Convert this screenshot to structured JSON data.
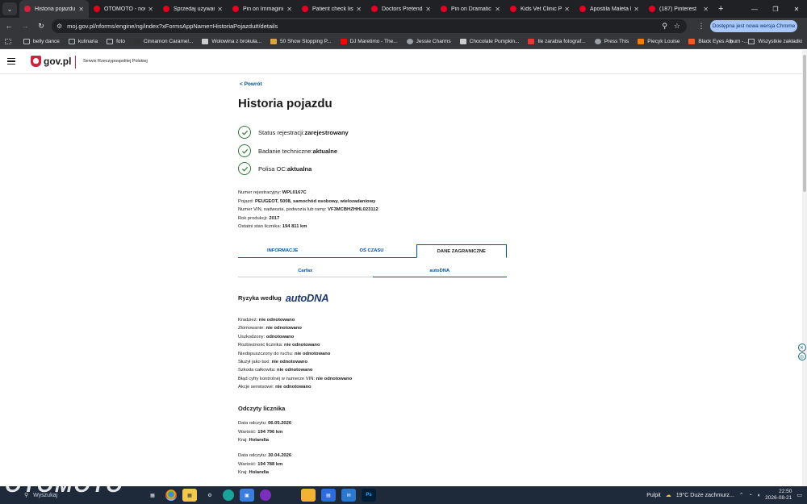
{
  "browser": {
    "tabs": [
      {
        "title": "Historia pojazdu",
        "active": true,
        "favicon_color": "#d4213d"
      },
      {
        "title": "OTOMOTO - nowe",
        "active": false,
        "favicon_color": "#e2001a"
      },
      {
        "title": "Sprzedaj używany",
        "active": false,
        "favicon_color": "#e2001a"
      },
      {
        "title": "Pin on Immagini",
        "active": false,
        "favicon_color": "#e60023"
      },
      {
        "title": "Patient check list",
        "active": false,
        "favicon_color": "#e60023"
      },
      {
        "title": "Doctors Pretend P",
        "active": false,
        "favicon_color": "#e60023"
      },
      {
        "title": "Pin on Dramatic P",
        "active": false,
        "favicon_color": "#e60023"
      },
      {
        "title": "Kids Vet Clinic Pa",
        "active": false,
        "favicon_color": "#e60023"
      },
      {
        "title": "Apostila Maleta M",
        "active": false,
        "favicon_color": "#e60023"
      },
      {
        "title": "(187) Pinterest",
        "active": false,
        "favicon_color": "#e60023"
      }
    ],
    "url": "moj.gov.pl/nforms/engine/ng/index?xFormsAppName=HistoriaPojazdu#/details",
    "update_notice": "Dostępna jest nowa wersja Chrome",
    "bookmarks": [
      {
        "label": "belly dance",
        "icon": "folder-icon"
      },
      {
        "label": "kulinaria",
        "icon": "folder-icon"
      },
      {
        "label": "foto",
        "icon": "folder-icon"
      },
      {
        "label": "Cinnamon Caramel...",
        "icon": "site-icon",
        "color": "#333333"
      },
      {
        "label": "Wołowina z brokuła...",
        "icon": "site-icon",
        "color": "#cccccc"
      },
      {
        "label": "50 Show Stopping P...",
        "icon": "site-icon",
        "color": "#d9a441"
      },
      {
        "label": "DJ Maretimo - The...",
        "icon": "youtube-icon",
        "color": "#ff0000"
      },
      {
        "label": "Jessie Charms",
        "icon": "globe-icon",
        "color": "#9aa0a6"
      },
      {
        "label": "Chocolate Pumpkin...",
        "icon": "site-icon",
        "color": "#cccccc"
      },
      {
        "label": "Ile zarabia fotograf...",
        "icon": "site-icon",
        "color": "#e53935"
      },
      {
        "label": "Press This",
        "icon": "globe-icon",
        "color": "#9aa0a6"
      },
      {
        "label": "Piecyk Louise",
        "icon": "site-icon",
        "color": "#f57c00"
      },
      {
        "label": "Black Eyes Album -...",
        "icon": "site-icon",
        "color": "#ff5722"
      }
    ],
    "bookmarks_all_label": "Wszystkie zakładki"
  },
  "site": {
    "logo": "gov.pl",
    "subtitle": "Serwis Rzeczypospolitej Polskiej",
    "brand_color": "#d4213d"
  },
  "page": {
    "back_link": "< Powrót",
    "title": "Historia pojazdu",
    "statuses": [
      {
        "label": "Status rejestracji:",
        "value": "zarejestrowany"
      },
      {
        "label": "Badanie techniczne:",
        "value": "aktualne"
      },
      {
        "label": "Polisa OC:",
        "value": "aktualna"
      }
    ],
    "details": [
      {
        "label": "Numer rejestracyjny:",
        "value": "WPL0167C"
      },
      {
        "label": "Pojazd:",
        "value": "PEUGEOT, 5008, samochód osobowy, wielozadaniowy"
      },
      {
        "label": "Numer VIN, nadwozia, podwozia lub ramy:",
        "value": "VF3MCBHZHHL023112"
      },
      {
        "label": "Rok produkcji:",
        "value": "2017"
      },
      {
        "label": "Ostatni stan licznika:",
        "value": "194 811 km"
      }
    ],
    "main_tabs": [
      {
        "label": "INFORMACJE",
        "active": false
      },
      {
        "label": "OŚ CZASU",
        "active": false
      },
      {
        "label": "DANE ZAGRANICZNE",
        "active": true
      }
    ],
    "sub_tabs": [
      {
        "label": "Carfax",
        "active": false
      },
      {
        "label": "autoDNA",
        "active": true
      }
    ],
    "risk_heading": "Ryzyka według",
    "risk_brand": "autoDNA",
    "risks": [
      {
        "label": "Kradzież:",
        "value": "nie odnotowano"
      },
      {
        "label": "Złomowanie:",
        "value": "nie odnotowano"
      },
      {
        "label": "Uszkodzony:",
        "value": "odnotowano"
      },
      {
        "label": "Rozbieżność licznika:",
        "value": "nie odnotowano"
      },
      {
        "label": "Niedopuszczony do ruchu:",
        "value": "nie odnotowano"
      },
      {
        "label": "Służył jako taxi:",
        "value": "nie odnotowano"
      },
      {
        "label": "Szkoda całkowita:",
        "value": "nie odnotowano"
      },
      {
        "label": "Błąd cyfry kontrolnej w numerze VIN:",
        "value": "nie odnotowano"
      },
      {
        "label": "Akcje serwisowe:",
        "value": "nie odnotowano"
      }
    ],
    "odometer_heading": "Odczyty licznika",
    "odometer_readings": [
      {
        "date_label": "Data odczytu:",
        "date": "06.05.2026",
        "value_label": "Wartość:",
        "value": "194 796 km",
        "country_label": "Kraj:",
        "country": "Holandia"
      },
      {
        "date_label": "Data odczytu:",
        "date": "30.04.2026",
        "value_label": "Wartość:",
        "value": "194 788 km",
        "country_label": "Kraj:",
        "country": "Holandia"
      }
    ]
  },
  "taskbar": {
    "search_placeholder": "Wyszukaj",
    "watermark": "OTOMOTO",
    "desktop_label": "Pulpit",
    "weather": "19°C  Duże zachmurz...",
    "time": "22:50",
    "date": "2026-08-21"
  }
}
